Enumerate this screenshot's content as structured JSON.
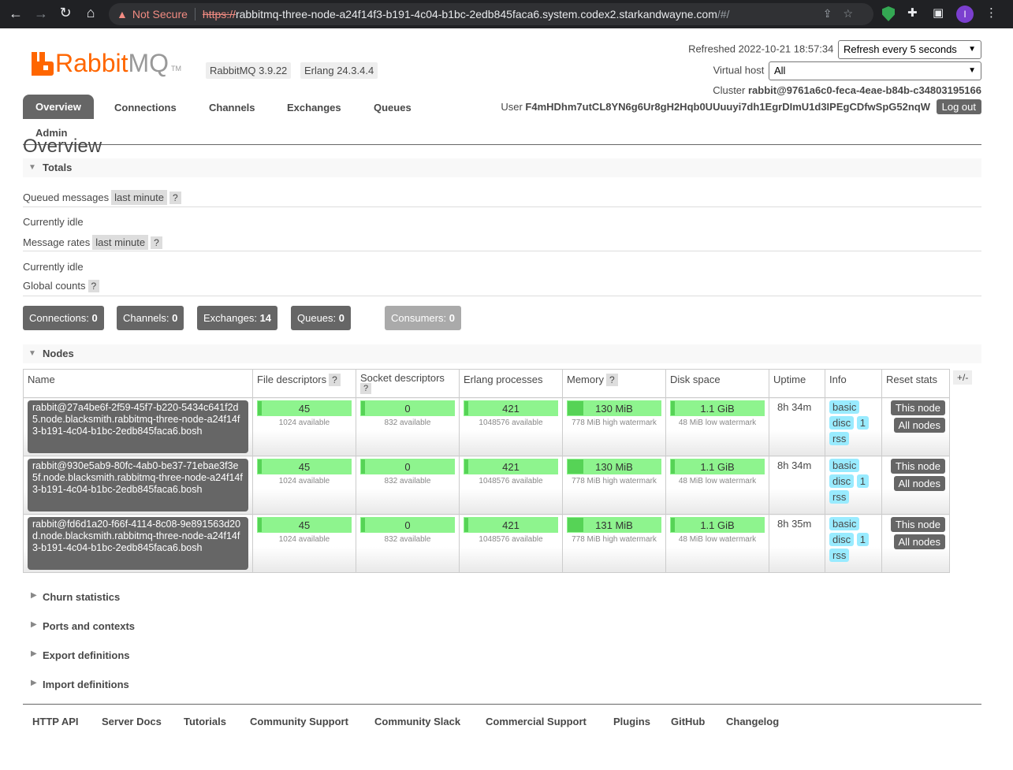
{
  "browser": {
    "security": "Not Secure",
    "scheme": "https://",
    "host": "rabbitmq-three-node-a24f14f3-b191-4c04-b1bc-2edb845faca6.system.codex2.starkandwayne.com",
    "path": "/#/",
    "profile_initial": "I"
  },
  "header": {
    "brand_rabbit": "Rabbit",
    "brand_mq": "MQ",
    "brand_tm": "TM",
    "rabbitmq_version": "RabbitMQ 3.9.22",
    "erlang_version": "Erlang 24.3.4.4",
    "refreshed_label": "Refreshed 2022-10-21 18:57:34",
    "refresh_option": "Refresh every 5 seconds",
    "vhost_label": "Virtual host",
    "vhost_value": "All",
    "cluster_label": "Cluster",
    "cluster_name": "rabbit@9761a6c0-feca-4eae-b84b-c34803195166",
    "user_label": "User",
    "user_name": "F4mHDhm7utCL8YN6g6Ur8gH2Hqb0UUuuyi7dh1EgrDImU1d3IPEgCDfwSpG52nqW",
    "logout": "Log out"
  },
  "nav": {
    "overview": "Overview",
    "connections": "Connections",
    "channels": "Channels",
    "exchanges": "Exchanges",
    "queues": "Queues",
    "admin": "Admin"
  },
  "page": {
    "title": "Overview",
    "totals": "Totals",
    "queued_messages": "Queued messages",
    "message_rates": "Message rates",
    "global_counts": "Global counts",
    "last_minute": "last minute",
    "help": "?",
    "idle": "Currently idle",
    "counts": [
      {
        "label": "Connections:",
        "value": "0"
      },
      {
        "label": "Channels:",
        "value": "0"
      },
      {
        "label": "Exchanges:",
        "value": "14"
      },
      {
        "label": "Queues:",
        "value": "0"
      },
      {
        "label": "Consumers:",
        "value": "0"
      }
    ],
    "nodes": "Nodes",
    "collapsed": [
      "Churn statistics",
      "Ports and contexts",
      "Export definitions",
      "Import definitions"
    ]
  },
  "nodes_table": {
    "headers": {
      "name": "Name",
      "fd": "File descriptors",
      "sd": "Socket descriptors",
      "ep": "Erlang processes",
      "mem": "Memory",
      "disk": "Disk space",
      "uptime": "Uptime",
      "info": "Info",
      "reset": "Reset stats"
    },
    "plus_minus": "+/-",
    "rows": [
      {
        "name": "rabbit@27a4be6f-2f59-45f7-b220-5434c641f2d5.node.blacksmith.rabbitmq-three-node-a24f14f3-b191-4c04-b1bc-2edb845faca6.bosh",
        "fd": "45",
        "fd_sub": "1024 available",
        "fd_frac": 0.044,
        "sd": "0",
        "sd_sub": "832 available",
        "sd_frac": 0.0,
        "ep": "421",
        "ep_sub": "1048576 available",
        "ep_frac": 0.0004,
        "mem": "130 MiB",
        "mem_sub": "778 MiB high watermark",
        "mem_frac": 0.167,
        "disk": "1.1 GiB",
        "disk_sub": "48 MiB low watermark",
        "disk_frac": 0.04,
        "uptime": "8h 34m",
        "info_basic": "basic",
        "info_disc": "disc",
        "info_disc_count": "1",
        "info_rss": "rss",
        "this_node": "This node",
        "all_nodes": "All nodes"
      },
      {
        "name": "rabbit@930e5ab9-80fc-4ab0-be37-71ebae3f3e5f.node.blacksmith.rabbitmq-three-node-a24f14f3-b191-4c04-b1bc-2edb845faca6.bosh",
        "fd": "45",
        "fd_sub": "1024 available",
        "fd_frac": 0.044,
        "sd": "0",
        "sd_sub": "832 available",
        "sd_frac": 0.0,
        "ep": "421",
        "ep_sub": "1048576 available",
        "ep_frac": 0.0004,
        "mem": "130 MiB",
        "mem_sub": "778 MiB high watermark",
        "mem_frac": 0.167,
        "disk": "1.1 GiB",
        "disk_sub": "48 MiB low watermark",
        "disk_frac": 0.04,
        "uptime": "8h 34m",
        "info_basic": "basic",
        "info_disc": "disc",
        "info_disc_count": "1",
        "info_rss": "rss",
        "this_node": "This node",
        "all_nodes": "All nodes"
      },
      {
        "name": "rabbit@fd6d1a20-f66f-4114-8c08-9e891563d20d.node.blacksmith.rabbitmq-three-node-a24f14f3-b191-4c04-b1bc-2edb845faca6.bosh",
        "fd": "45",
        "fd_sub": "1024 available",
        "fd_frac": 0.044,
        "sd": "0",
        "sd_sub": "832 available",
        "sd_frac": 0.0,
        "ep": "421",
        "ep_sub": "1048576 available",
        "ep_frac": 0.0004,
        "mem": "131 MiB",
        "mem_sub": "778 MiB high watermark",
        "mem_frac": 0.168,
        "disk": "1.1 GiB",
        "disk_sub": "48 MiB low watermark",
        "disk_frac": 0.04,
        "uptime": "8h 35m",
        "info_basic": "basic",
        "info_disc": "disc",
        "info_disc_count": "1",
        "info_rss": "rss",
        "this_node": "This node",
        "all_nodes": "All nodes"
      }
    ]
  },
  "footer": [
    "HTTP API",
    "Server Docs",
    "Tutorials",
    "Community Support",
    "Community Slack",
    "Commercial Support",
    "Plugins",
    "GitHub",
    "Changelog"
  ]
}
